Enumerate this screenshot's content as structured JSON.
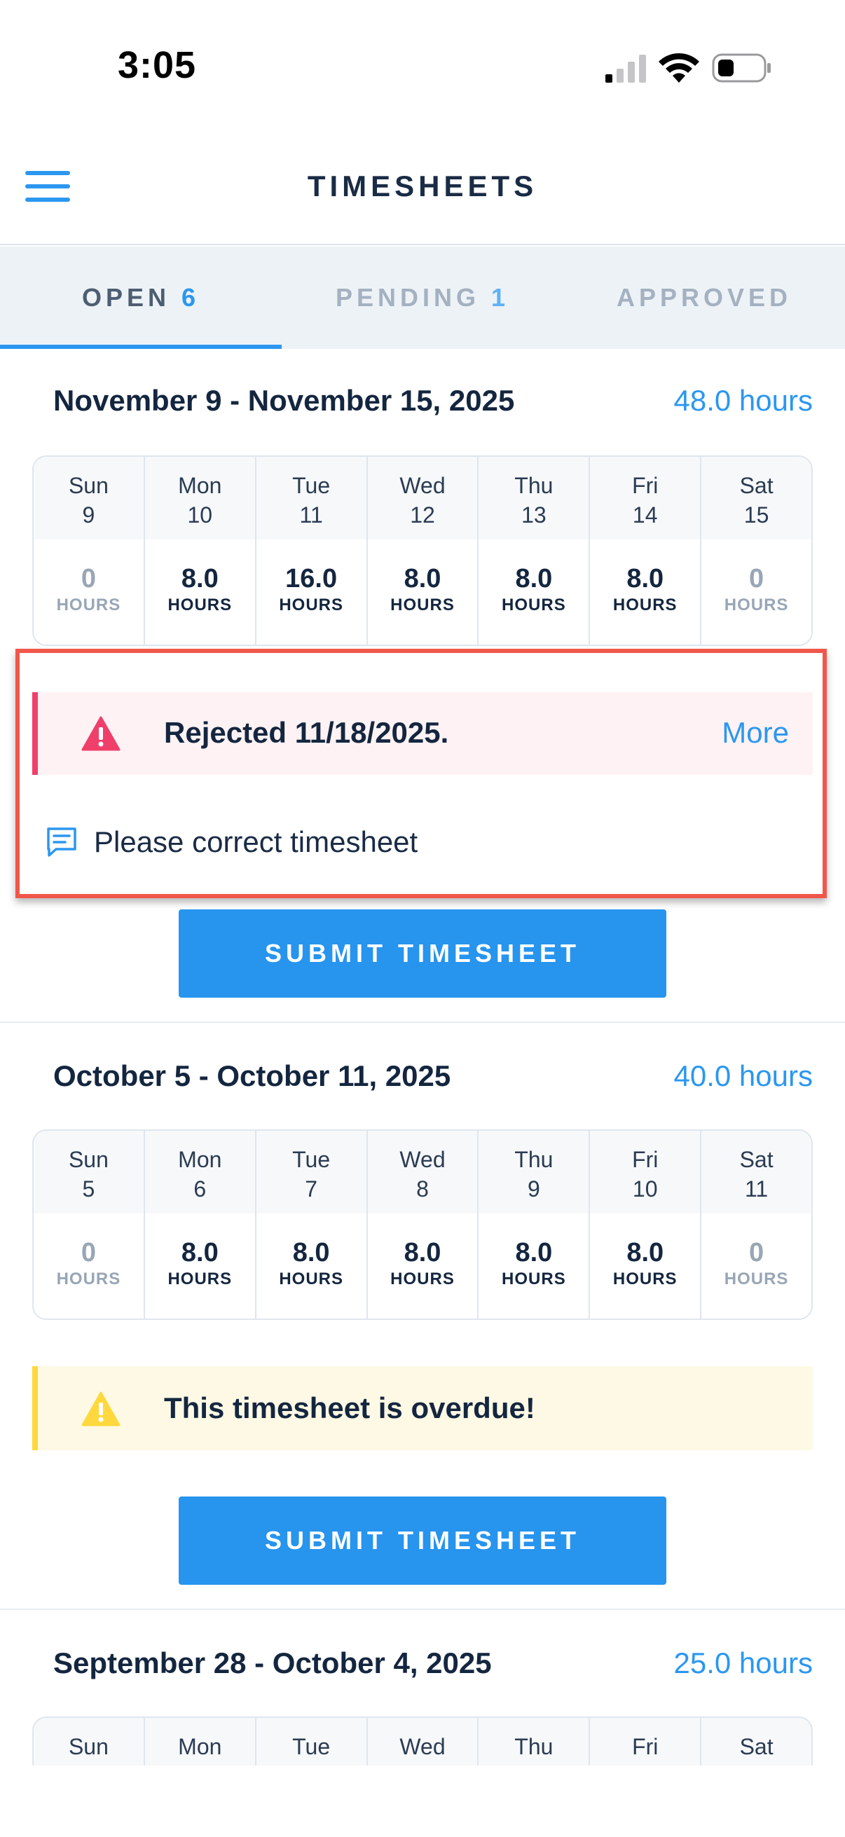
{
  "status_bar": {
    "time": "3:05"
  },
  "header": {
    "title": "TIMESHEETS"
  },
  "tabs": [
    {
      "label": "OPEN",
      "count": "6",
      "active": true
    },
    {
      "label": "PENDING",
      "count": "1",
      "active": false
    },
    {
      "label": "APPROVED",
      "count": "",
      "active": false
    }
  ],
  "hours_label": "HOURS",
  "weeks": [
    {
      "range": "November 9 - November 15, 2025",
      "total": "48.0 hours",
      "days": [
        {
          "name": "Sun",
          "date": "9",
          "hours": "0"
        },
        {
          "name": "Mon",
          "date": "10",
          "hours": "8.0"
        },
        {
          "name": "Tue",
          "date": "11",
          "hours": "16.0"
        },
        {
          "name": "Wed",
          "date": "12",
          "hours": "8.0"
        },
        {
          "name": "Thu",
          "date": "13",
          "hours": "8.0"
        },
        {
          "name": "Fri",
          "date": "14",
          "hours": "8.0"
        },
        {
          "name": "Sat",
          "date": "15",
          "hours": "0"
        }
      ],
      "alert": {
        "text": "Rejected 11/18/2025.",
        "more": "More"
      },
      "comment": "Please correct timesheet",
      "submit_label": "SUBMIT TIMESHEET"
    },
    {
      "range": "October 5 - October 11, 2025",
      "total": "40.0 hours",
      "days": [
        {
          "name": "Sun",
          "date": "5",
          "hours": "0"
        },
        {
          "name": "Mon",
          "date": "6",
          "hours": "8.0"
        },
        {
          "name": "Tue",
          "date": "7",
          "hours": "8.0"
        },
        {
          "name": "Wed",
          "date": "8",
          "hours": "8.0"
        },
        {
          "name": "Thu",
          "date": "9",
          "hours": "8.0"
        },
        {
          "name": "Fri",
          "date": "10",
          "hours": "8.0"
        },
        {
          "name": "Sat",
          "date": "11",
          "hours": "0"
        }
      ],
      "warning": "This timesheet is overdue!",
      "submit_label": "SUBMIT TIMESHEET"
    },
    {
      "range": "September 28 - October 4, 2025",
      "total": "25.0 hours",
      "days": [
        {
          "name": "Sun"
        },
        {
          "name": "Mon"
        },
        {
          "name": "Tue"
        },
        {
          "name": "Wed"
        },
        {
          "name": "Thu"
        },
        {
          "name": "Fri"
        },
        {
          "name": "Sat"
        }
      ]
    }
  ],
  "colors": {
    "accent": "#2b97f0",
    "rejected": "#ef3f6a",
    "warning": "#ffd83d",
    "highlight": "#f0574a"
  }
}
